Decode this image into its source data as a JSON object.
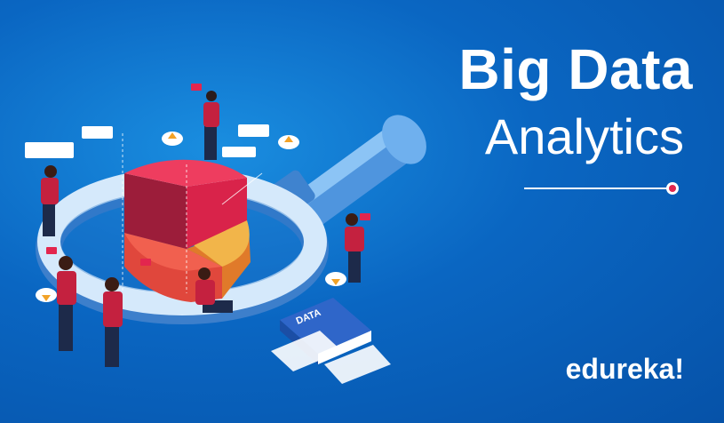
{
  "title": {
    "line1": "Big Data",
    "line2": "Analytics"
  },
  "logo": {
    "text": "edureka!"
  },
  "illustration": {
    "book_label": "DATA"
  },
  "colors": {
    "background": "#0a66c2",
    "accent": "#e3264e",
    "pie_red": "#d9234a",
    "pie_orange": "#f0883a",
    "pie_yellow": "#f2b54a",
    "pie_coral": "#f15a4a",
    "magnifier": "#5aa8ea"
  },
  "icons": [
    "magnifying-glass-icon",
    "pie-chart-icon",
    "cloud-upload-icon",
    "cloud-download-icon",
    "speech-bubble-icon",
    "data-book-icon"
  ]
}
